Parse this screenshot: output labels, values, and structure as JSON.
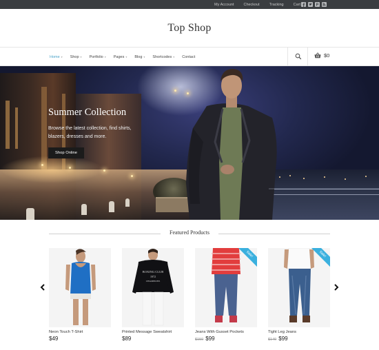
{
  "topbar": {
    "links": [
      "My Account",
      "Checkout",
      "Tracking",
      "Cart"
    ],
    "social": [
      "facebook-icon",
      "twitter-icon",
      "pinterest-icon",
      "rss-icon"
    ]
  },
  "brand": {
    "title": "Top Shop"
  },
  "nav": {
    "items": [
      {
        "label": "Home",
        "active": true,
        "has_submenu": true
      },
      {
        "label": "Shop",
        "active": false,
        "has_submenu": true
      },
      {
        "label": "Portfolio",
        "active": false,
        "has_submenu": true
      },
      {
        "label": "Pages",
        "active": false,
        "has_submenu": true
      },
      {
        "label": "Blog",
        "active": false,
        "has_submenu": true
      },
      {
        "label": "Shortcodes",
        "active": false,
        "has_submenu": true
      },
      {
        "label": "Contact",
        "active": false,
        "has_submenu": false
      }
    ],
    "cart_total": "$0",
    "accent": "#4aa3c8"
  },
  "hero": {
    "title": "Summer Collection",
    "text": "Browse the latest collection, find shirts, blazers, dresses and more.",
    "button": "Shop Online"
  },
  "featured": {
    "title": "Featured Products",
    "products": [
      {
        "name": "Neon Touch T-Shirt",
        "price": "$49",
        "old_price": "",
        "sale": ""
      },
      {
        "name": "Printed Message Sweatshirt",
        "price": "$89",
        "old_price": "",
        "sale": ""
      },
      {
        "name": "Jeans With Gusset Pockets",
        "price": "$99",
        "old_price": "$150",
        "sale": "Sale!"
      },
      {
        "name": "Tight Leg Jeans",
        "price": "$99",
        "old_price": "$149",
        "sale": "Sale!"
      }
    ]
  }
}
